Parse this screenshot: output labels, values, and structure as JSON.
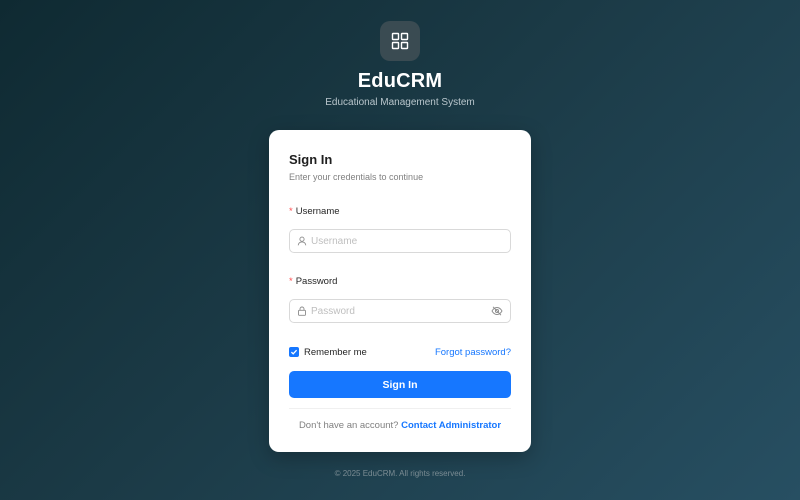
{
  "app": {
    "title": "EduCRM",
    "subtitle": "Educational Management System",
    "logo_icon": "grid-icon"
  },
  "login": {
    "title": "Sign In",
    "subtitle": "Enter your credentials to continue",
    "username": {
      "label": "Username",
      "required_mark": "*",
      "placeholder": "Username",
      "value": "",
      "icon": "user-icon"
    },
    "password": {
      "label": "Password",
      "required_mark": "*",
      "placeholder": "Password",
      "value": "",
      "icon": "lock-icon",
      "toggle_icon": "eye-off-icon"
    },
    "remember_me": {
      "label": "Remember me",
      "checked": true
    },
    "forgot_password": "Forgot password?",
    "submit_label": "Sign In",
    "footer_text": "Don't have an account?",
    "footer_link": "Contact Administrator"
  },
  "copyright": "© 2025 EduCRM. All rights reserved.",
  "colors": {
    "primary": "#1677ff",
    "required": "#ff4d4f",
    "background_start": "#0f2a32",
    "background_end": "#274f62"
  }
}
